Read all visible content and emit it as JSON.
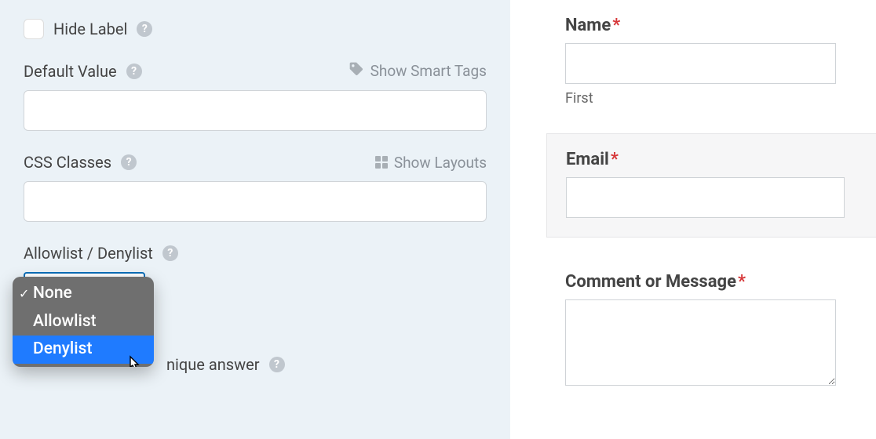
{
  "left": {
    "hide_label_text": "Hide Label",
    "default_value_label": "Default Value",
    "default_value_input": "",
    "smart_tags_text": "Show Smart Tags",
    "css_classes_label": "CSS Classes",
    "css_classes_input": "",
    "show_layouts_text": "Show Layouts",
    "allowlist_label": "Allowlist / Denylist",
    "unique_answer_text": "nique answer",
    "dropdown": {
      "opt0": "None",
      "opt1": "Allowlist",
      "opt2": "Denylist"
    }
  },
  "right": {
    "name_label": "Name",
    "name_sub_label": "First",
    "email_label": "Email",
    "comment_label": "Comment or Message"
  }
}
